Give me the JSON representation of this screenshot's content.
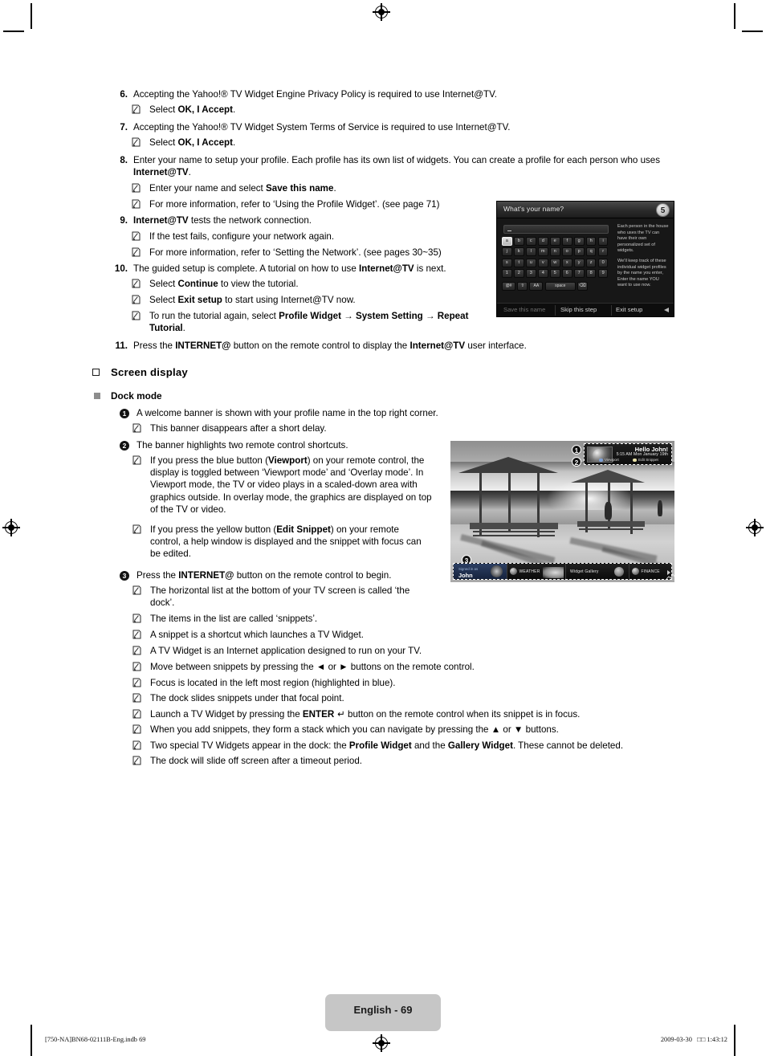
{
  "document": {
    "page_label": "English - 69",
    "footer_left": "[750-NA]BN68-02111B-Eng.indb   69",
    "footer_right": "2009-03-30   □□ 1:43:12"
  },
  "steps": [
    {
      "number": "6.",
      "text_html": "Accepting the Yahoo!® TV Widget Engine Privacy Policy is required to use Internet@TV.",
      "notes": [
        {
          "text_html": "Select <b>OK, I Accept</b>."
        }
      ]
    },
    {
      "number": "7.",
      "text_html": "Accepting the Yahoo!® TV Widget System Terms of Service is required to use Internet@TV.",
      "notes": [
        {
          "text_html": "Select <b>OK, I Accept</b>."
        }
      ]
    },
    {
      "number": "8.",
      "text_html": "Enter your name to setup your profile. Each profile has its own list of widgets. You can create a profile for each person who uses <b>Internet@TV</b>.",
      "notes": [
        {
          "text_html": "Enter your name and select <b>Save this name</b>."
        },
        {
          "text_html": "For more information, refer to ‘Using the Profile Widget’. (see page 71)"
        }
      ]
    },
    {
      "number": "9.",
      "text_html": "<b>Internet@TV</b> tests the network connection.",
      "notes": [
        {
          "text_html": "If the test fails, configure your network again."
        },
        {
          "text_html": "For more information, refer to ‘Setting the Network’. (see pages 30~35)"
        }
      ]
    },
    {
      "number": "10.",
      "text_html": "The guided setup is complete. A tutorial on how to use <b>Internet@TV</b> is next.",
      "notes": [
        {
          "text_html": "Select <b>Continue</b> to view the tutorial."
        },
        {
          "text_html": "Select <b>Exit setup</b> to start using Internet@TV now."
        },
        {
          "text_html": "To run the tutorial again, select <b>Profile Widget → System Setting → Repeat Tutorial</b>."
        }
      ]
    },
    {
      "number": "11.",
      "text_html": "Press the <b>INTERNET@</b> button on the remote control to display the <b>Internet@TV</b> user interface.",
      "notes": []
    }
  ],
  "section": {
    "heading": "Screen display",
    "subheading": "Dock mode",
    "items": [
      {
        "marker": "1",
        "text_html": "A welcome banner is shown with your profile name in the top right corner.",
        "notes": [
          {
            "text_html": "This banner disappears after a short delay."
          }
        ]
      },
      {
        "marker": "2",
        "text_html": "The banner highlights two remote control shortcuts.",
        "notes": [
          {
            "text_html": "If you press the blue button (<b>Viewport</b>) on your remote control, the display is toggled between ‘Viewport mode’ and ‘Overlay mode’. In Viewport mode, the TV or video plays in a scaled-down area with graphics outside. In overlay mode, the graphics are displayed on top of the TV or video."
          },
          {
            "text_html": "If you press the yellow button (<b>Edit Snippet</b>) on your remote control, a help window is displayed and the snippet with focus can be edited."
          }
        ]
      },
      {
        "marker": "3",
        "text_html": "Press the <b>INTERNET@</b> button on the remote control to begin.",
        "notes": [
          {
            "text_html": "The horizontal list at the bottom of your TV screen is called ‘the dock’."
          },
          {
            "text_html": "The items in the list are called ‘snippets’."
          },
          {
            "text_html": "A snippet is a shortcut which launches a TV Widget."
          },
          {
            "text_html": "A TV Widget is an Internet application designed to run on your TV."
          },
          {
            "text_html": "Move between snippets by pressing the ◄ or ► buttons on the remote control."
          },
          {
            "text_html": "Focus is located in the left most region (highlighted in blue)."
          },
          {
            "text_html": "The dock slides snippets under that focal point."
          },
          {
            "text_html": "Launch a TV Widget by pressing the <b>ENTER</b> ↵ button on the remote control when its snippet is in focus."
          },
          {
            "text_html": "When you add snippets, they form a stack which you can navigate by pressing the ▲ or ▼ buttons."
          },
          {
            "text_html": "Two special TV Widgets appear in the dock: the <b>Profile Widget</b> and the <b>Gallery Widget</b>. These cannot be deleted."
          },
          {
            "text_html": "The dock will slide off screen after a timeout period."
          }
        ]
      }
    ]
  },
  "screenshot_name_dialog": {
    "title": "What's your name?",
    "step_badge": "5",
    "input_value": "",
    "keyboard_rows": [
      [
        "a",
        "b",
        "c",
        "d",
        "e",
        "f",
        "g",
        "h",
        "i"
      ],
      [
        "j",
        "k",
        "l",
        "m",
        "n",
        "o",
        "p",
        "q",
        "r"
      ],
      [
        "s",
        "t",
        "u",
        "v",
        "w",
        "x",
        "y",
        "z",
        "0"
      ],
      [
        "1",
        "2",
        "3",
        "4",
        "5",
        "6",
        "7",
        "8",
        "9"
      ]
    ],
    "keyboard_selected": "a",
    "keyboard_bottom": [
      "@#",
      "⇧",
      "AA",
      "space",
      "⌫"
    ],
    "help_paragraphs": [
      "Each person in the house who uses the TV can have their own personalized set of widgets.",
      "We'll keep track of these individual widget profiles by the name you enter, Enter the name YOU want to use now."
    ],
    "buttons": [
      "Save this name",
      "Skip this step",
      "Exit setup"
    ],
    "buttons_disabled": [
      "Save this name"
    ]
  },
  "screenshot_dock": {
    "banner": {
      "greeting": "Hello John!",
      "datetime": "5:15 AM Mon January 19th",
      "shortcut_blue": "Viewport",
      "shortcut_yellow": "Edit Snippet",
      "color_blue": "#7d9fd6",
      "color_yellow": "#e9e3a8"
    },
    "callouts": [
      "1",
      "2",
      "3"
    ],
    "dock_snippets": [
      {
        "kind": "profile",
        "line1": "Signed in as",
        "line2": "John"
      },
      {
        "kind": "widget",
        "label": "WEATHER"
      },
      {
        "kind": "gallery",
        "label": "Widget Gallery"
      },
      {
        "kind": "widget",
        "label": "FINANCE"
      }
    ]
  }
}
